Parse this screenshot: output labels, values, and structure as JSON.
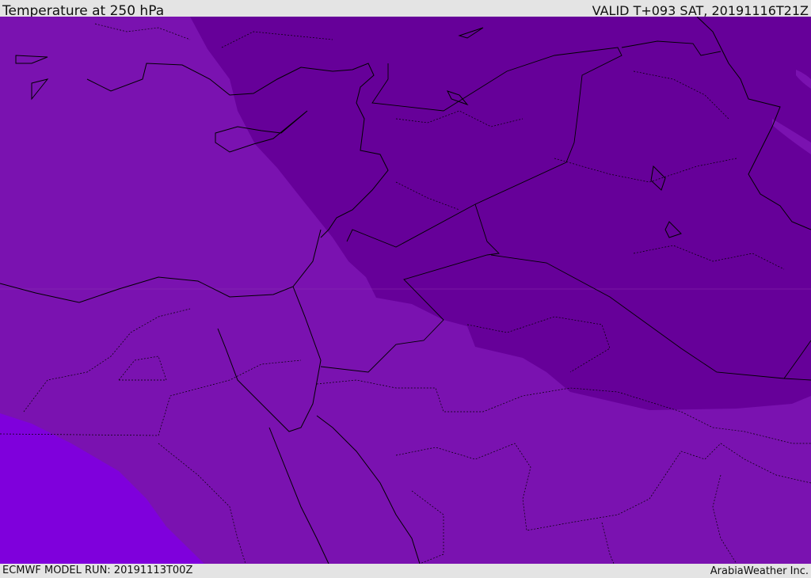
{
  "header": {
    "title": "Temperature at 250 hPa",
    "valid": "VALID T+093 SAT, 20191116T21Z"
  },
  "footer": {
    "model_run": "ECMWF MODEL RUN: 20191113T00Z",
    "brand": "ArabiaWeather Inc."
  },
  "colors": {
    "mid_purple": "#7a12b0",
    "dark_purple": "#660099",
    "bright_violet": "#7f00dc",
    "boundary": "#000000"
  }
}
